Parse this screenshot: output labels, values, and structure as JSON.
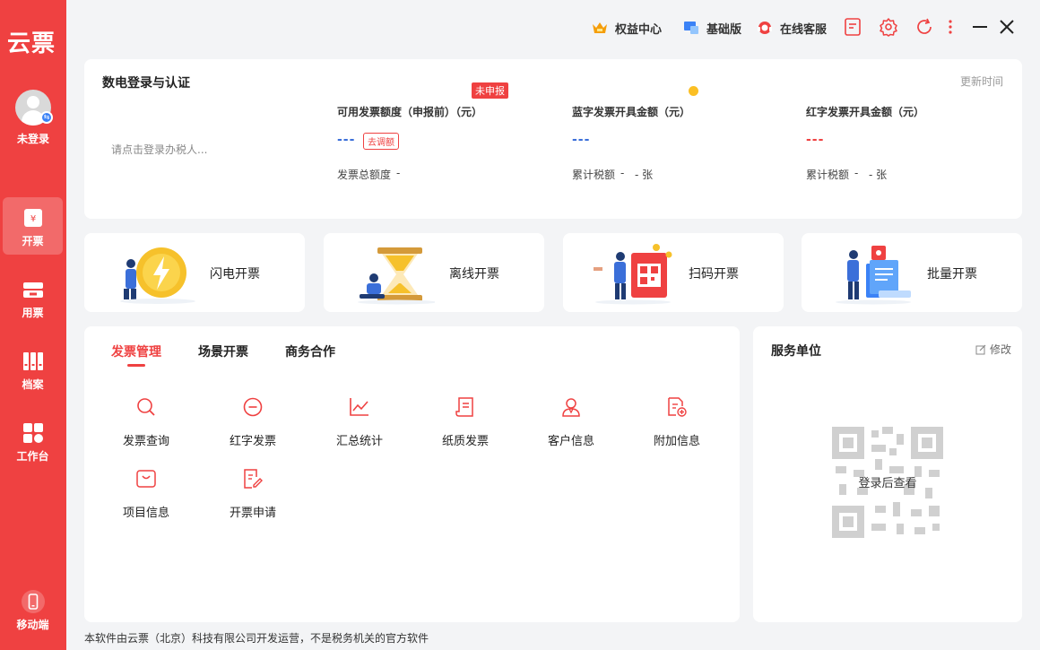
{
  "app": {
    "logo": "云票"
  },
  "user": {
    "status": "未登录"
  },
  "sidebar": {
    "items": [
      {
        "label": "开票",
        "icon": "invoice-icon",
        "active": true
      },
      {
        "label": "用票",
        "icon": "ticket-icon"
      },
      {
        "label": "档案",
        "icon": "archive-icon"
      },
      {
        "label": "工作台",
        "icon": "workbench-icon"
      }
    ],
    "mobile_label": "移动端"
  },
  "topbar": {
    "rights_center": "权益中心",
    "basic_edition": "基础版",
    "online_service": "在线客服"
  },
  "login_card": {
    "title": "数电登录与认证",
    "placeholder": "请点击登录办税人...",
    "refresh_time": "更新时间",
    "stats": [
      {
        "label": "可用发票额度（申报前）（元）",
        "value": "---",
        "badge": "未申报",
        "action": "去调额",
        "sub_label": "发票总额度",
        "sub_value": "-",
        "color": "#3b6fd9"
      },
      {
        "label": "蓝字发票开具金额（元）",
        "value": "---",
        "sub_label": "累计税额",
        "sub_value": "-",
        "sub_count": "- 张",
        "color": "#3b6fd9"
      },
      {
        "label": "红字发票开具金额（元）",
        "value": "---",
        "sub_label": "累计税额",
        "sub_value": "-",
        "sub_count": "- 张",
        "color": "#ef4141"
      }
    ]
  },
  "quick_actions": [
    {
      "label": "闪电开票",
      "icon": "lightning-coin-icon"
    },
    {
      "label": "离线开票",
      "icon": "hourglass-icon"
    },
    {
      "label": "扫码开票",
      "icon": "qr-scan-icon"
    },
    {
      "label": "批量开票",
      "icon": "batch-docs-icon"
    }
  ],
  "tabs": [
    {
      "label": "发票管理",
      "active": true
    },
    {
      "label": "场景开票"
    },
    {
      "label": "商务合作"
    }
  ],
  "functions": [
    {
      "label": "发票查询",
      "icon": "search-icon"
    },
    {
      "label": "红字发票",
      "icon": "minus-circle-icon"
    },
    {
      "label": "汇总统计",
      "icon": "line-chart-icon"
    },
    {
      "label": "纸质发票",
      "icon": "paper-invoice-icon"
    },
    {
      "label": "客户信息",
      "icon": "customer-icon"
    },
    {
      "label": "附加信息",
      "icon": "add-doc-icon"
    },
    {
      "label": "项目信息",
      "icon": "project-icon"
    },
    {
      "label": "开票申请",
      "icon": "apply-edit-icon"
    }
  ],
  "service_unit": {
    "title": "服务单位",
    "edit_label": "修改",
    "qr_text": "登录后查看"
  },
  "footer": {
    "text": "本软件由云票（北京）科技有限公司开发运营，不是税务机关的官方软件"
  }
}
